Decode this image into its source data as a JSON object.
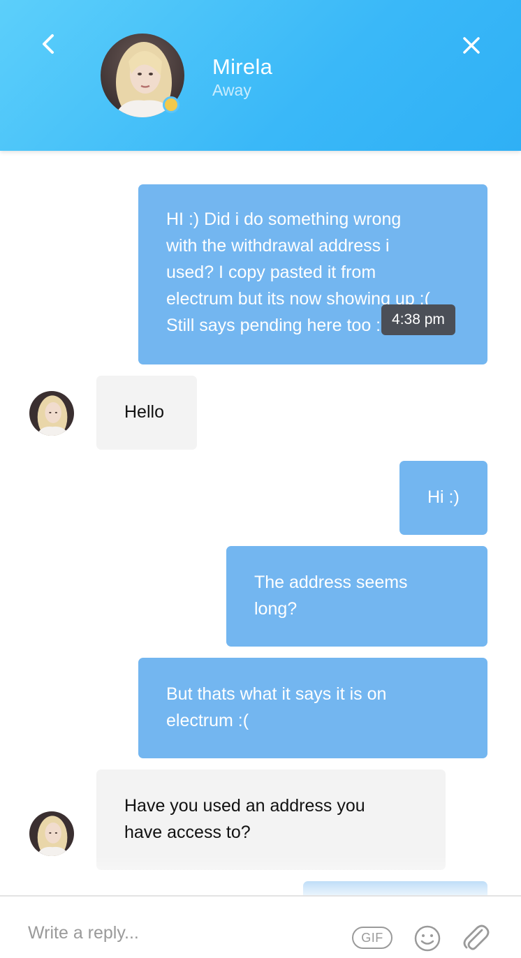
{
  "header": {
    "contact_name": "Mirela",
    "contact_status": "Away",
    "status_color": "#f2c94c",
    "back_icon": "chevron-left-icon",
    "close_icon": "close-icon"
  },
  "tooltip": {
    "time": "4:38 pm"
  },
  "messages": [
    {
      "direction": "outgoing",
      "lines": [
        "HI :) Did i do something wrong",
        "with the withdrawal address i",
        "used? I copy pasted it from",
        "electrum but its now showing up :(",
        "Still says pending here too :("
      ]
    },
    {
      "direction": "incoming",
      "lines": [
        "Hello"
      ]
    },
    {
      "direction": "outgoing",
      "lines": [
        "Hi :)"
      ]
    },
    {
      "direction": "outgoing",
      "lines": [
        "The address seems",
        "long?"
      ]
    },
    {
      "direction": "outgoing",
      "lines": [
        "But thats what it says it is on",
        "electrum :("
      ]
    },
    {
      "direction": "incoming",
      "lines": [
        "Have you used an address you",
        "have access to?"
      ]
    },
    {
      "direction": "outgoing",
      "lines": [
        ""
      ]
    }
  ],
  "composer": {
    "placeholder": "Write a reply...",
    "gif_label": "GIF",
    "emoji_icon": "smiley-icon",
    "attach_icon": "paperclip-icon"
  },
  "colors": {
    "header_gradient_start": "#5ccffa",
    "header_gradient_end": "#2fb0f5",
    "outgoing_bubble": "#73b6f0",
    "incoming_bubble": "#f3f3f3"
  }
}
